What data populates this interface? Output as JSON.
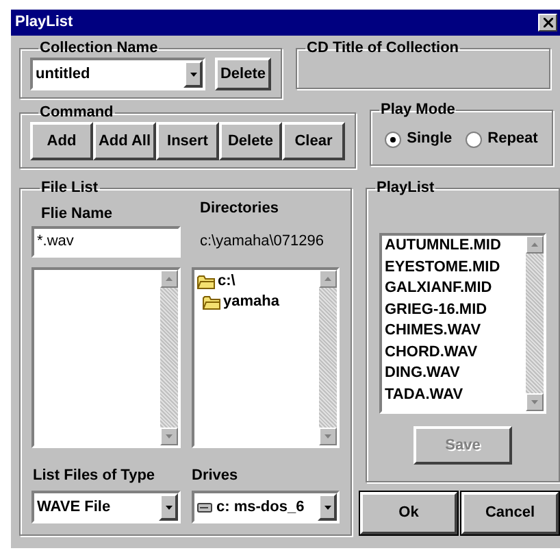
{
  "window": {
    "title": "PlayList"
  },
  "collection_name": {
    "label": "Collection Name",
    "value": "untitled",
    "delete_button": "Delete"
  },
  "cd_title": {
    "label": "CD Title of Collection"
  },
  "command": {
    "label": "Command",
    "buttons": [
      "Add",
      "Add All",
      "Insert",
      "Delete",
      "Clear"
    ]
  },
  "play_mode": {
    "label": "Play Mode",
    "options": [
      {
        "label": "Single",
        "selected": true
      },
      {
        "label": "Repeat",
        "selected": false
      }
    ]
  },
  "file_list": {
    "label": "File List",
    "file_name_label": "Flie Name",
    "file_name": "*.wav",
    "directories_label": "Directories",
    "current_path": "c:\\yamaha\\071296",
    "directories": [
      {
        "name": "c:\\",
        "children": [
          {
            "name": "yamaha"
          }
        ]
      }
    ],
    "file_type_label": "List Files of Type",
    "file_type": "WAVE File",
    "drives_label": "Drives",
    "drive": "c: ms-dos_6"
  },
  "playlist": {
    "label": "PlayList",
    "items": [
      "AUTUMNLE.MID",
      "EYESTOME.MID",
      "GALXIANF.MID",
      "GRIEG-16.MID",
      "CHIMES.WAV",
      "CHORD.WAV",
      "DING.WAV",
      "TADA.WAV"
    ],
    "save": {
      "label": "Save",
      "disabled": true
    }
  },
  "buttons": [
    "Ok",
    "Cancel"
  ]
}
